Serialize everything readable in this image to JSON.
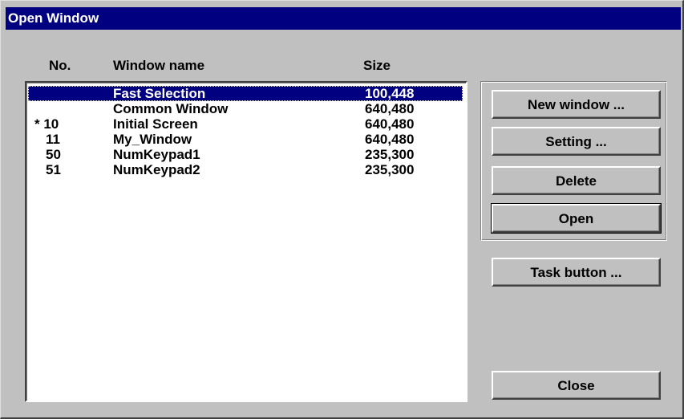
{
  "window": {
    "title": "Open Window"
  },
  "columns": {
    "no": "No.",
    "name": "Window name",
    "size": "Size"
  },
  "rows": [
    {
      "no": "",
      "name": "Fast Selection",
      "size": "100,448",
      "selected": true
    },
    {
      "no": "",
      "name": "Common Window",
      "size": "640,480",
      "selected": false
    },
    {
      "no": "* 10",
      "name": "Initial Screen",
      "size": "640,480",
      "selected": false
    },
    {
      "no": "11",
      "name": "My_Window",
      "size": "640,480",
      "selected": false
    },
    {
      "no": "50",
      "name": "NumKeypad1",
      "size": "235,300",
      "selected": false
    },
    {
      "no": "51",
      "name": "NumKeypad2",
      "size": "235,300",
      "selected": false
    }
  ],
  "buttons": {
    "new_window": "New window ...",
    "setting": "Setting ...",
    "delete": "Delete",
    "open": "Open",
    "task_button": "Task button ...",
    "close": "Close"
  },
  "colors": {
    "title_bar": "#000080",
    "selection": "#000080",
    "dialog_face": "#c0c0c0"
  }
}
